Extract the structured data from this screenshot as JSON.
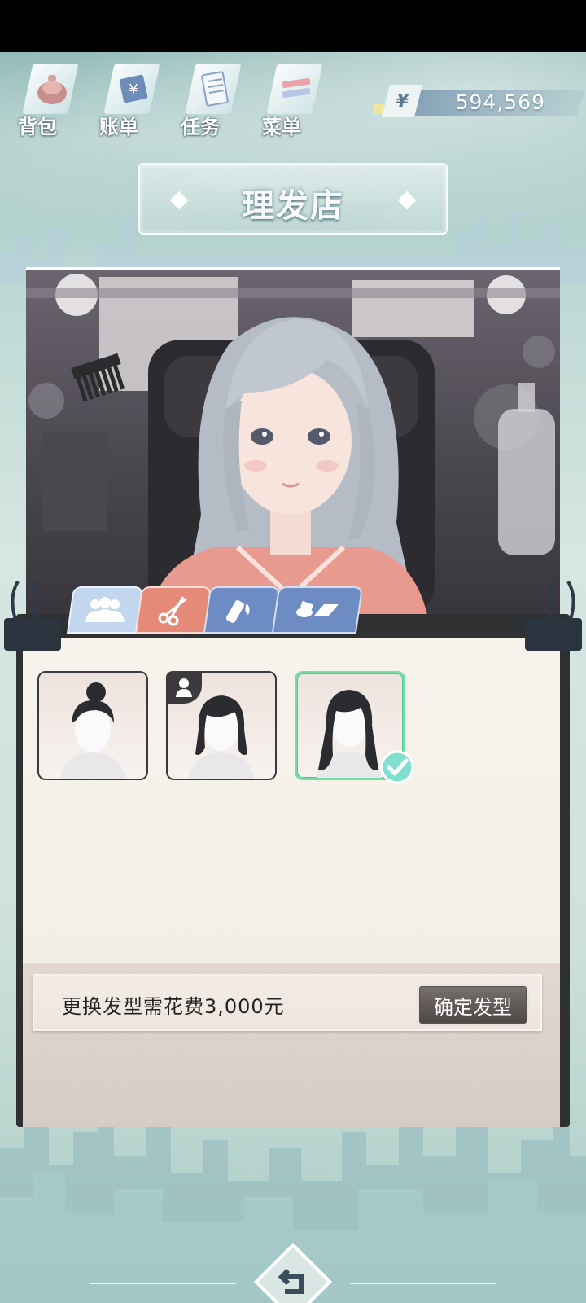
{
  "top_menu": [
    {
      "label": "背包",
      "icon": "bag-icon"
    },
    {
      "label": "账单",
      "icon": "bill-icon"
    },
    {
      "label": "任务",
      "icon": "task-icon"
    },
    {
      "label": "菜单",
      "icon": "menu-icon"
    }
  ],
  "currency": {
    "symbol": "¥",
    "value": "594,569"
  },
  "title": "理发店",
  "tabs": [
    {
      "icon": "people-icon",
      "active": false
    },
    {
      "icon": "scissors-icon",
      "active": true
    },
    {
      "icon": "makeup-icon",
      "active": false
    },
    {
      "icon": "accessories-icon",
      "active": false
    }
  ],
  "hairstyles": [
    {
      "name": "bun-hairstyle",
      "locked": false,
      "selected": false
    },
    {
      "name": "medium-hairstyle",
      "locked": true,
      "selected": false
    },
    {
      "name": "long-hairstyle",
      "locked": false,
      "selected": true
    }
  ],
  "cost": {
    "text": "更换发型需花费3,000元",
    "confirm_label": "确定发型"
  },
  "colors": {
    "accent_selected": "#72e0a6",
    "tab_active": "#e58a78",
    "tab_inactive": "#6e8cc4"
  }
}
